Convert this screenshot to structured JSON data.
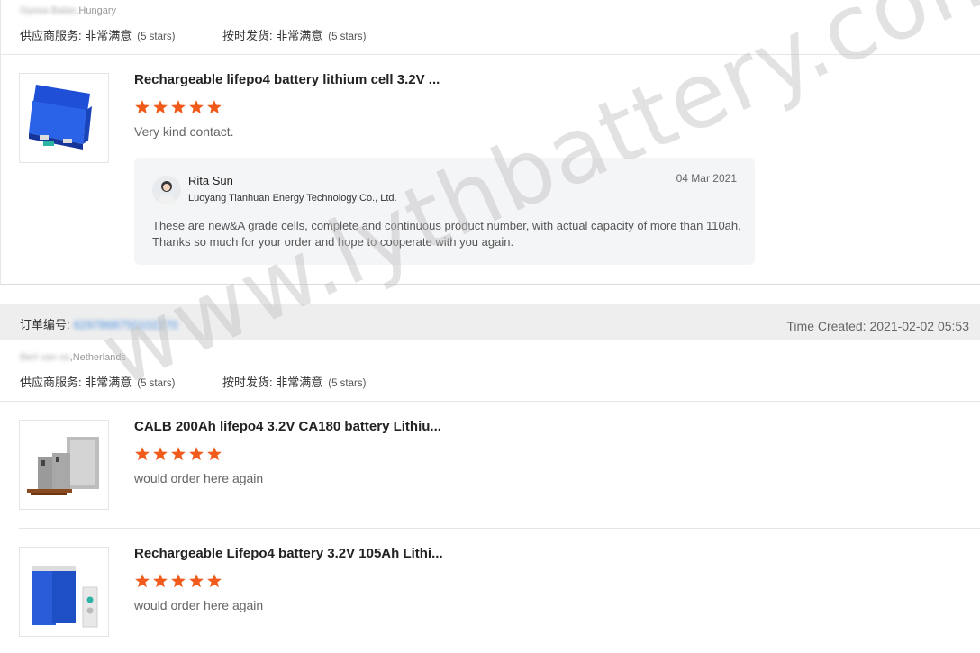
{
  "review1": {
    "buyer_name": "Gyosa Balas",
    "buyer_country": ",Hungary",
    "supplier_service_label": "供应商服务: 非常满意",
    "supplier_service_stars": "(5 stars)",
    "ontime_label": "按时发货: 非常满意",
    "ontime_stars": "(5 stars)",
    "product_title": "Rechargeable lifepo4 battery lithium cell 3.2V ...",
    "rating": 5,
    "review_text": "Very kind contact.",
    "reply": {
      "name": "Rita Sun",
      "company": "Luoyang Tianhuan Energy Technology Co., Ltd.",
      "date": "04 Mar 2021",
      "text": "These are new&A grade cells, complete and continuous product number, with actual capacity of more than 110ah, Thanks so much for your order and hope to cooperate with you again."
    }
  },
  "order": {
    "label": "订单编号:",
    "number": "6297868750102270",
    "time_created": "Time Created: 2021-02-02 05:53"
  },
  "review2": {
    "buyer_name": "Bert van os",
    "buyer_country": ",Netherlands",
    "supplier_service_label": "供应商服务: 非常满意",
    "supplier_service_stars": "(5 stars)",
    "ontime_label": "按时发货: 非常满意",
    "ontime_stars": "(5 stars)",
    "items": [
      {
        "product_title": "CALB 200Ah lifepo4 3.2V CA180 battery Lithiu...",
        "rating": 5,
        "review_text": "would order here again"
      },
      {
        "product_title": "Rechargeable Lifepo4 battery 3.2V 105Ah Lithi...",
        "rating": 5,
        "review_text": "would order here again"
      }
    ]
  },
  "watermark": "www.lythbattery.com",
  "colors": {
    "star": "#f05a1a",
    "link": "#4a90e2",
    "order_bar": "#eeeeee"
  }
}
